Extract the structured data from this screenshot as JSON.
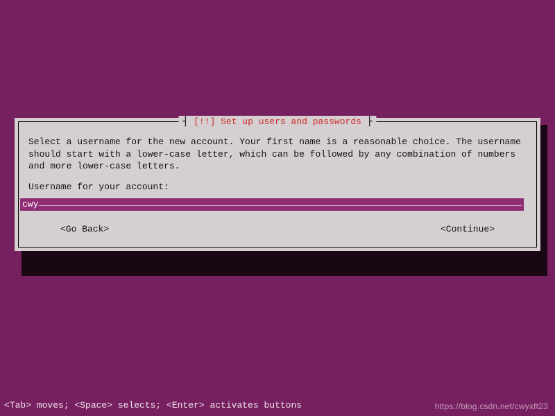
{
  "dialog": {
    "title_prefix": "[!!] ",
    "title": "Set up users and passwords",
    "instructions": "Select a username for the new account. Your first name is a reasonable choice. The username should start with a lower-case letter, which can be followed by any combination of numbers and more lower-case letters.",
    "field_label": "Username for your account:",
    "input_value": "cwy",
    "buttons": {
      "back": "<Go Back>",
      "continue": "<Continue>"
    }
  },
  "footer": {
    "hint": "<Tab> moves; <Space> selects; <Enter> activates buttons"
  },
  "watermark": "https://blog.csdn.net/cwyxft23",
  "colors": {
    "background": "#772060",
    "panel": "#d5cfd1",
    "input_bg": "#8f2d75",
    "title_accent": "#d02a2a"
  }
}
